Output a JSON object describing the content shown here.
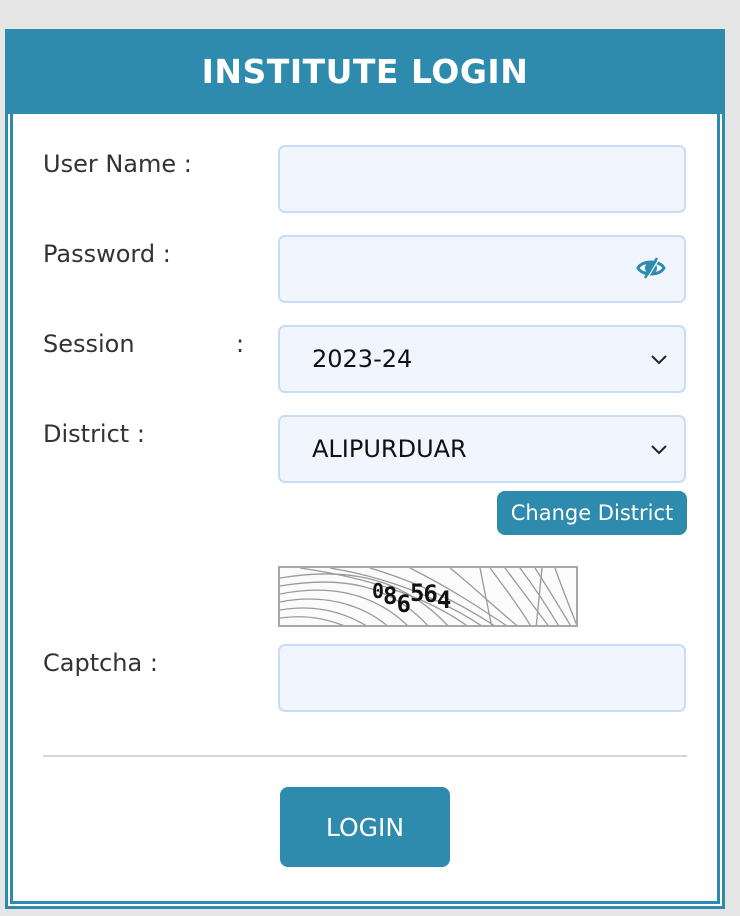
{
  "header": {
    "title": "INSTITUTE LOGIN"
  },
  "form": {
    "username": {
      "label": "User Name :",
      "value": ""
    },
    "password": {
      "label": "Password :",
      "value": "",
      "toggle_icon": "eye-slash-icon"
    },
    "session": {
      "label": "Session",
      "colon": ":",
      "selected": "2023-24"
    },
    "district": {
      "label": "District :",
      "selected": "ALIPURDUAR",
      "change_button": "Change District"
    },
    "captcha": {
      "label": "Captcha :",
      "image_text": [
        "0",
        "8",
        "6",
        "5",
        "6",
        "4"
      ],
      "value": ""
    },
    "login_button": "LOGIN"
  },
  "colors": {
    "accent": "#2e8bae",
    "field_bg": "#f1f6fe",
    "field_border": "#c6dcf8",
    "page_bg": "#e6e6e6"
  }
}
